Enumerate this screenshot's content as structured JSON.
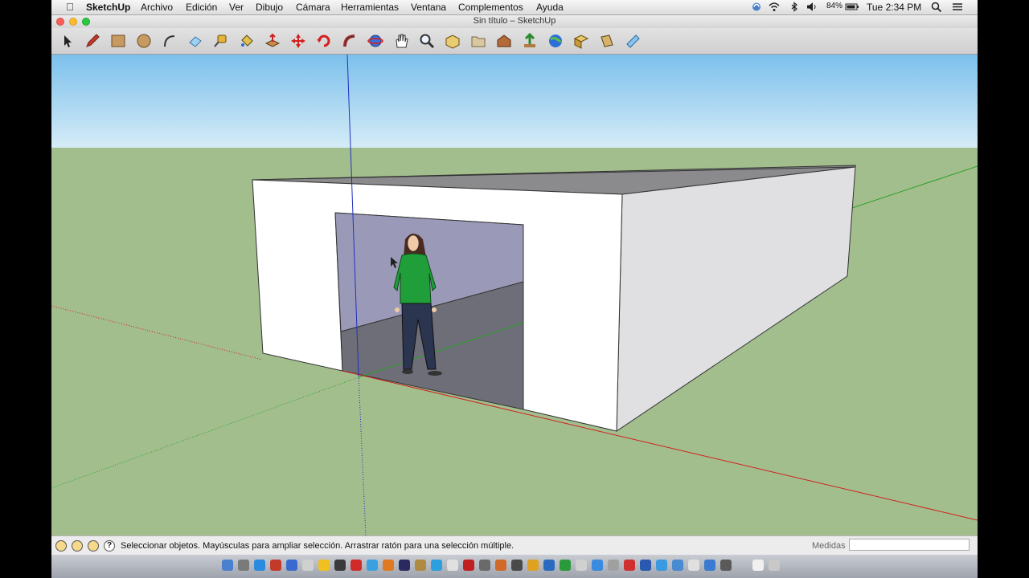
{
  "menubar": {
    "app": "SketchUp",
    "items": [
      "Archivo",
      "Edición",
      "Ver",
      "Dibujo",
      "Cámara",
      "Herramientas",
      "Ventana",
      "Complementos",
      "Ayuda"
    ],
    "battery": "84%",
    "clock": "Tue 2:34 PM"
  },
  "window": {
    "title": "Sin título – SketchUp"
  },
  "toolbar": {
    "tools": [
      "select-tool",
      "pencil-tool",
      "rectangle-tool",
      "circle-tool",
      "arc-tool",
      "eraser-tool",
      "tape-measure-tool",
      "paint-bucket-tool",
      "push-pull-tool",
      "move-tool",
      "rotate-tool",
      "follow-me-tool",
      "orbit-tool",
      "pan-tool",
      "zoom-tool",
      "zoom-extents-tool",
      "previous-view-tool",
      "warehouse-tool",
      "share-model-tool",
      "google-earth-tool",
      "components-tool",
      "extension-tool",
      "layout-tool"
    ]
  },
  "statusbar": {
    "message": "Seleccionar objetos. Mayúsculas para ampliar selección. Arrastrar ratón para una selección múltiple.",
    "measure_label": "Medidas",
    "measure_value": ""
  },
  "colors": {
    "sky": "#a9d3ee",
    "ground": "#a3be8d",
    "wall_front": "#ffffff",
    "wall_side": "#e0e0e3",
    "roof": "#8b8b8d",
    "interior_wall": "#9a9ab8",
    "interior_floor": "#6e6e78",
    "figure_shirt": "#1f9e3a",
    "axis_red": "#d02020",
    "axis_green": "#2aa02a",
    "axis_blue": "#2030c0"
  }
}
